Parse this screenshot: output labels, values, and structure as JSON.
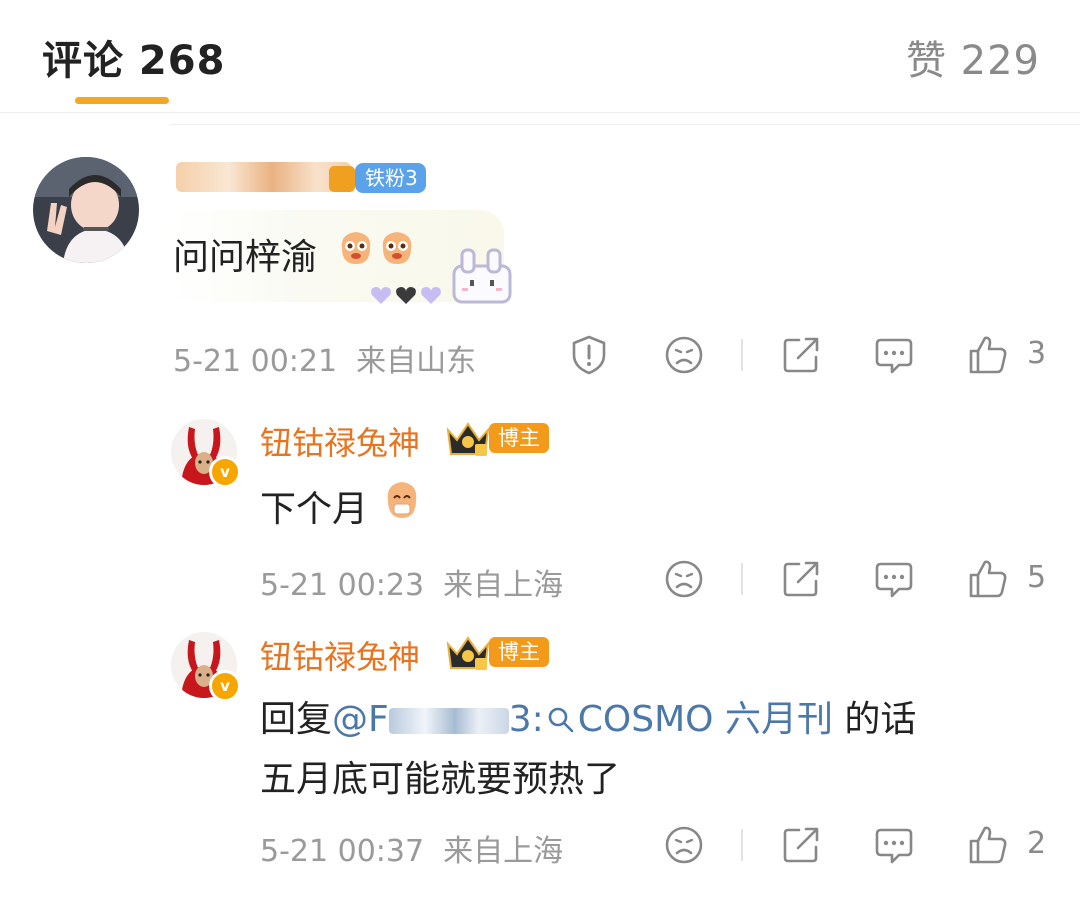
{
  "tabs": {
    "comments_label": "评论 268",
    "likes_label": "赞 229"
  },
  "comment1": {
    "badge": "铁粉3",
    "text": "问问梓渝",
    "time": "5-21 00:21",
    "location": "来自山东",
    "likes": "3"
  },
  "reply1": {
    "username": "钮钴禄兔神",
    "badge": "博主",
    "text": "下个月",
    "time": "5-21 00:23",
    "location": "来自上海",
    "likes": "5"
  },
  "reply2": {
    "username": "钮钴禄兔神",
    "badge": "博主",
    "reply_prefix": "回复",
    "mention": "@F",
    "mention_tail": "3:",
    "topic": "COSMO 六月刊",
    "line1_tail": " 的话",
    "line2": "五月底可能就要预热了",
    "time": "5-21 00:37",
    "location": "来自上海",
    "likes": "2"
  },
  "colors": {
    "accent": "#f5a623",
    "username": "#e8741f",
    "link": "#4b78a9",
    "fan_badge": "#5aa2ea",
    "host_badge": "#f39a1a"
  },
  "icons": [
    "report-icon",
    "dislike-icon",
    "share-icon",
    "comment-icon",
    "like-icon",
    "verified-icon",
    "crown-icon",
    "heart-icon",
    "search-icon"
  ]
}
